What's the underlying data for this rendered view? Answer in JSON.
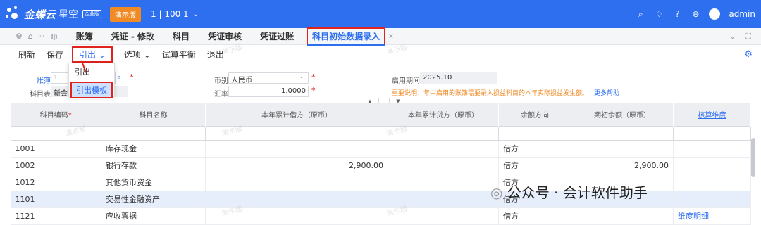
{
  "app": {
    "brand": "金蝶云",
    "brand_sub": "星空",
    "edition": "企业版",
    "demo_badge": "演示版",
    "account": "1 | 100 1",
    "user": "admin"
  },
  "tabs": {
    "items": [
      {
        "label": "账簿"
      },
      {
        "label": "凭证 - 修改"
      },
      {
        "label": "科目"
      },
      {
        "label": "凭证审核"
      },
      {
        "label": "凭证过账"
      }
    ],
    "active": "科目初始数据录入"
  },
  "toolbar": {
    "refresh": "刷新",
    "save": "保存",
    "export": "引出",
    "options": "选项",
    "trial_balance": "试算平衡",
    "exit": "退出"
  },
  "export_menu": {
    "item1": "引出",
    "item2": "引出模板"
  },
  "form": {
    "book_label": "账簿",
    "book_value": "1",
    "chart_label": "科目表",
    "chart_value": "新会计",
    "currency_label": "币别",
    "currency_value": "人民币",
    "rate_label": "汇率",
    "rate_value": "1.0000",
    "period_label": "启用期间",
    "period_value": "2025.10",
    "notice": "重要说明：年中启用的账簿需要录入损益科目的本年实际损益发生额。",
    "more_help": "更多帮助"
  },
  "table": {
    "headers": [
      "科目编码",
      "科目名称",
      "本年累计借方（原币）",
      "本年累计贷方（原币）",
      "余额方向",
      "期初余额（原币）",
      "核算维度"
    ],
    "rows": [
      {
        "code": "1001",
        "name": "库存现金",
        "debit": "",
        "credit": "",
        "dir": "借方",
        "balance": "",
        "dim": ""
      },
      {
        "code": "1002",
        "name": "银行存款",
        "debit": "2,900.00",
        "credit": "",
        "dir": "借方",
        "balance": "2,900.00",
        "dim": ""
      },
      {
        "code": "1012",
        "name": "其他货币资金",
        "debit": "",
        "credit": "",
        "dir": "借方",
        "balance": "",
        "dim": ""
      },
      {
        "code": "1101",
        "name": "交易性金融资产",
        "debit": "",
        "credit": "",
        "dir": "借方",
        "balance": "",
        "dim": ""
      },
      {
        "code": "1121",
        "name": "应收票据",
        "debit": "",
        "credit": "",
        "dir": "借方",
        "balance": "",
        "dim": "维度明细"
      }
    ]
  },
  "watermark": {
    "brand": "公众号 · 会计软件助手",
    "demo": "演示版"
  },
  "colors": {
    "primary": "#2e6ff0",
    "highlight_box": "#e0241d",
    "demo_badge": "#f08a24"
  }
}
